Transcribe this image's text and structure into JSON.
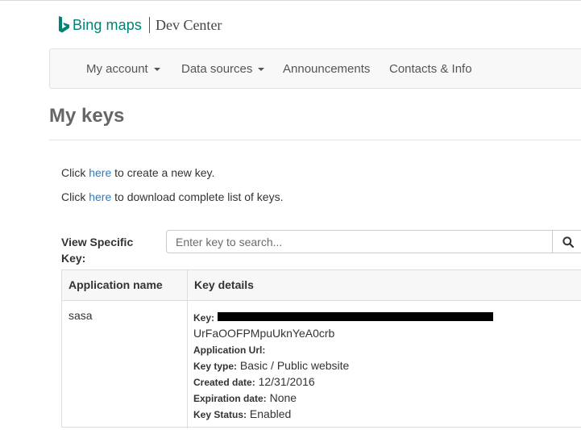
{
  "header": {
    "brand": "Bing maps",
    "section": "Dev Center"
  },
  "nav": {
    "items": [
      {
        "label": "My account",
        "dropdown": true
      },
      {
        "label": "Data sources",
        "dropdown": true
      },
      {
        "label": "Announcements",
        "dropdown": false
      },
      {
        "label": "Contacts & Info",
        "dropdown": false
      }
    ]
  },
  "page": {
    "title": "My keys",
    "create_line": {
      "prefix": "Click ",
      "link": "here",
      "suffix": " to create a new key."
    },
    "download_line": {
      "prefix": "Click ",
      "link": "here",
      "suffix": " to download complete list of keys."
    }
  },
  "search": {
    "label": "View Specific Key:",
    "placeholder": "Enter key to search...",
    "icon": "search-icon"
  },
  "table": {
    "headers": [
      "Application name",
      "Key details"
    ],
    "rows": [
      {
        "application_name": "sasa",
        "key_label": "Key:",
        "key_value_redacted": true,
        "key_tail": "UrFaOOFPMpuUknYeA0crb",
        "application_url_label": "Application Url:",
        "application_url": "",
        "key_type_label": "Key type:",
        "key_type": "Basic / Public website",
        "created_label": "Created date:",
        "created": "12/31/2016",
        "expiration_label": "Expiration date:",
        "expiration": "None",
        "status_label": "Key Status:",
        "status": "Enabled"
      }
    ]
  },
  "colors": {
    "brand_teal": "#008373",
    "link_blue": "#337ab7"
  }
}
